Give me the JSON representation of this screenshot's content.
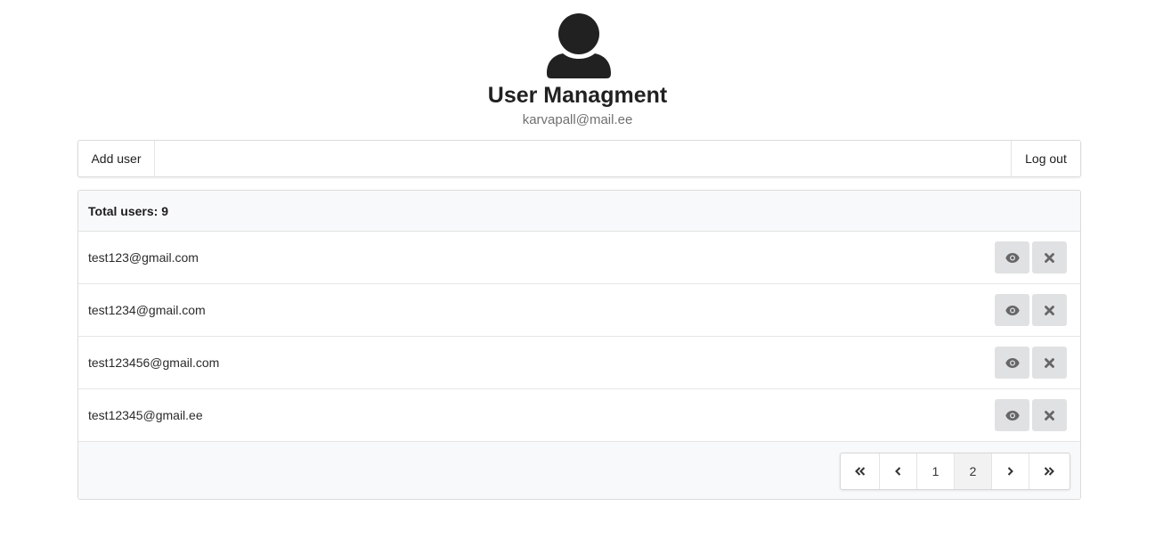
{
  "header": {
    "avatar_icon": "user-icon",
    "title": "User Managment",
    "subtitle": "karvapall@mail.ee"
  },
  "menu": {
    "add_user": "Add user",
    "log_out": "Log out"
  },
  "panel": {
    "total_label": "Total users: 9",
    "users": [
      {
        "email": "test123@gmail.com"
      },
      {
        "email": "test1234@gmail.com"
      },
      {
        "email": "test123456@gmail.com"
      },
      {
        "email": "test12345@gmail.ee"
      }
    ],
    "row_actions": {
      "view_icon": "eye-icon",
      "delete_icon": "close-icon"
    }
  },
  "pagination": {
    "first_icon": "double-chevron-left-icon",
    "prev_icon": "chevron-left-icon",
    "pages": [
      "1",
      "2"
    ],
    "active_page": "2",
    "next_icon": "chevron-right-icon",
    "last_icon": "double-chevron-right-icon"
  },
  "colors": {
    "icon_dark": "#212121",
    "button_bg": "#e0e1e2",
    "button_icon": "#666666",
    "panel_bg": "#f8f9fa"
  }
}
